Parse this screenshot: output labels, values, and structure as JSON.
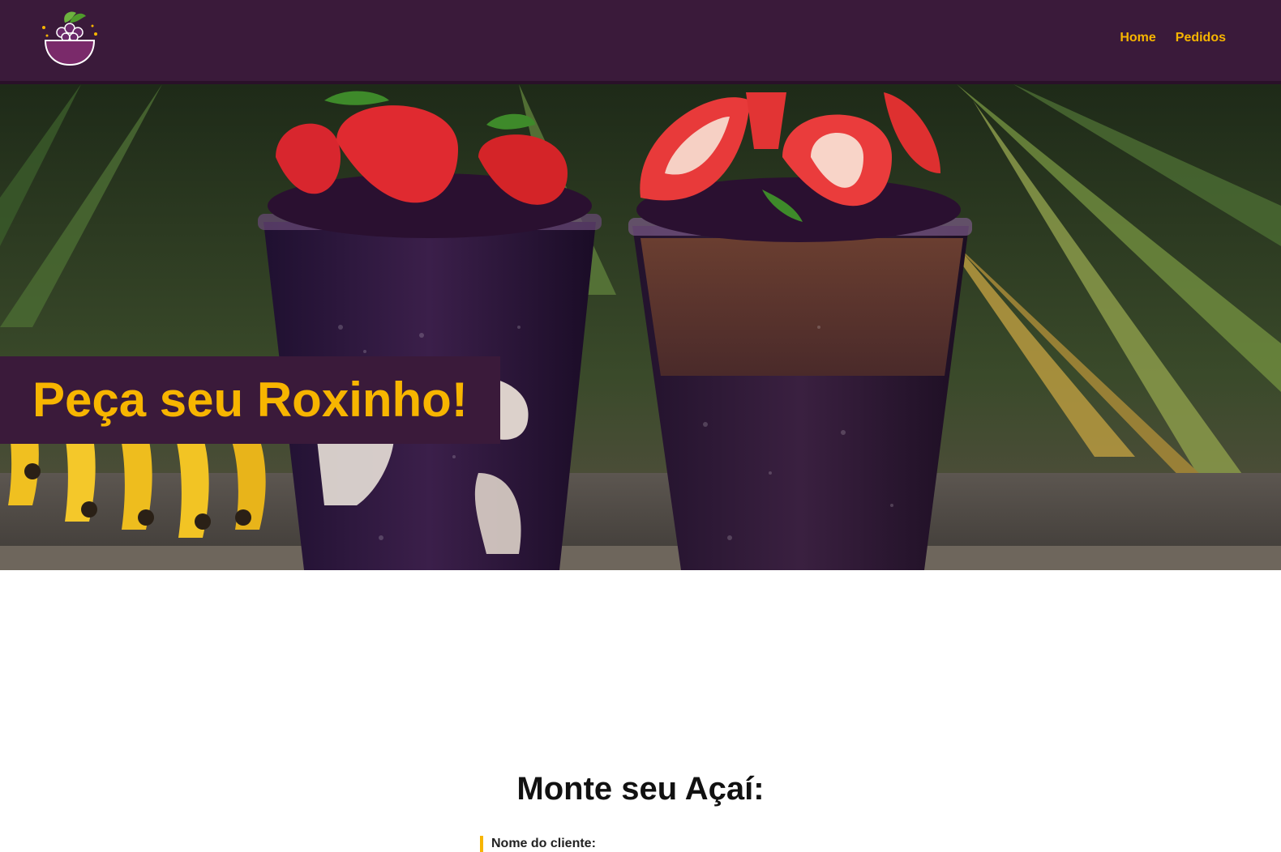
{
  "brand": {
    "logo_icon": "acai-bowl-logo-icon",
    "accent_color": "#f7b500",
    "primary_color": "#3a1a3a"
  },
  "nav": {
    "items": [
      {
        "label": "Home"
      },
      {
        "label": "Pedidos"
      }
    ]
  },
  "hero": {
    "title": "Peça seu Roxinho!",
    "image": "acai-cups-with-strawberries-and-bananas"
  },
  "order_section": {
    "title": "Monte seu Açaí:",
    "fields": [
      {
        "label": "Nome do cliente:"
      }
    ]
  }
}
